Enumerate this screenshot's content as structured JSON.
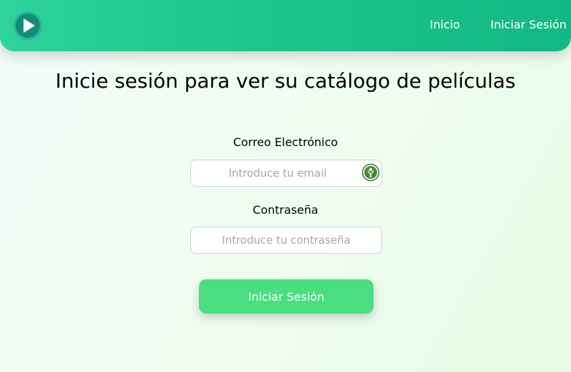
{
  "navbar": {
    "logo_icon": "play-icon",
    "links": [
      {
        "label": "Inicio"
      },
      {
        "label": "Iniciar Sesión"
      }
    ],
    "colors": {
      "start": "#2ed39b",
      "end": "#13b884"
    }
  },
  "main": {
    "title": "Inicie sesión para ver su catálogo de películas",
    "form": {
      "email": {
        "label": "Correo Electrónico",
        "placeholder": "Introduce tu email",
        "value": "",
        "icon": "password-manager-icon"
      },
      "password": {
        "label": "Contraseña",
        "placeholder": "Introduce tu contraseña",
        "value": ""
      },
      "submit_label": "Iniciar Sesión",
      "submit_color": "#4ade80"
    }
  }
}
